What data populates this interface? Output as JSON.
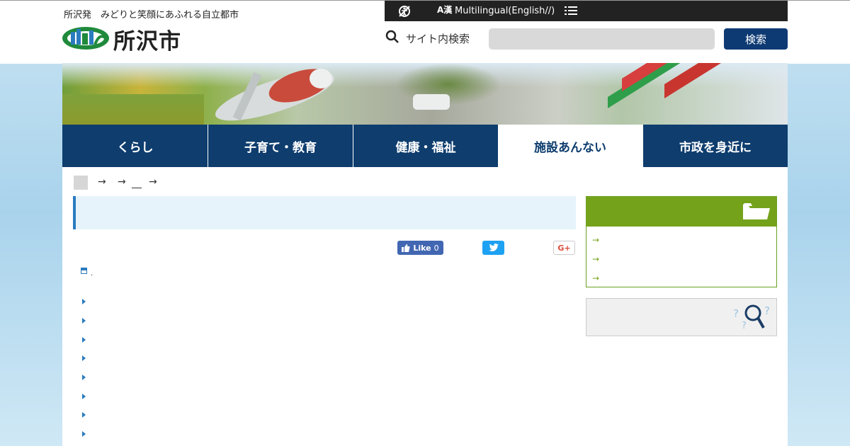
{
  "header": {
    "tagline": "所沢発　みどりと笑顔にあふれる自立都市",
    "logo_text": "所沢市",
    "lang_icon": "A漢",
    "multilingual_label": "Multilingual(English//)",
    "search_label": "サイト内検索",
    "search_placeholder": "",
    "search_button_label": "検索"
  },
  "nav": {
    "items": [
      {
        "label": "くらし"
      },
      {
        "label": "子育て・教育"
      },
      {
        "label": "健康・福祉"
      },
      {
        "label": "施設あんない"
      },
      {
        "label": "市政を身近に"
      }
    ],
    "active_index": 3
  },
  "breadcrumb": {
    "separator": "→"
  },
  "social": {
    "fb_label": "Like",
    "fb_count": "0",
    "gplus_label": "G+"
  },
  "content": {
    "doc_suffix": ".",
    "list_count": 8
  },
  "sidebar": {
    "link_arrow": "→"
  },
  "colors": {
    "nav_bg": "#0e3d6e",
    "accent_blue": "#2a7bbf",
    "sidebar_green": "#74a31b",
    "search_button": "#0d3a73"
  },
  "icons": [
    "accessibility-icon",
    "language-icon",
    "menu-list-icon",
    "search-icon",
    "home-icon",
    "folder-icon",
    "help-search-icon",
    "facebook-icon",
    "twitter-icon",
    "googleplus-icon"
  ]
}
